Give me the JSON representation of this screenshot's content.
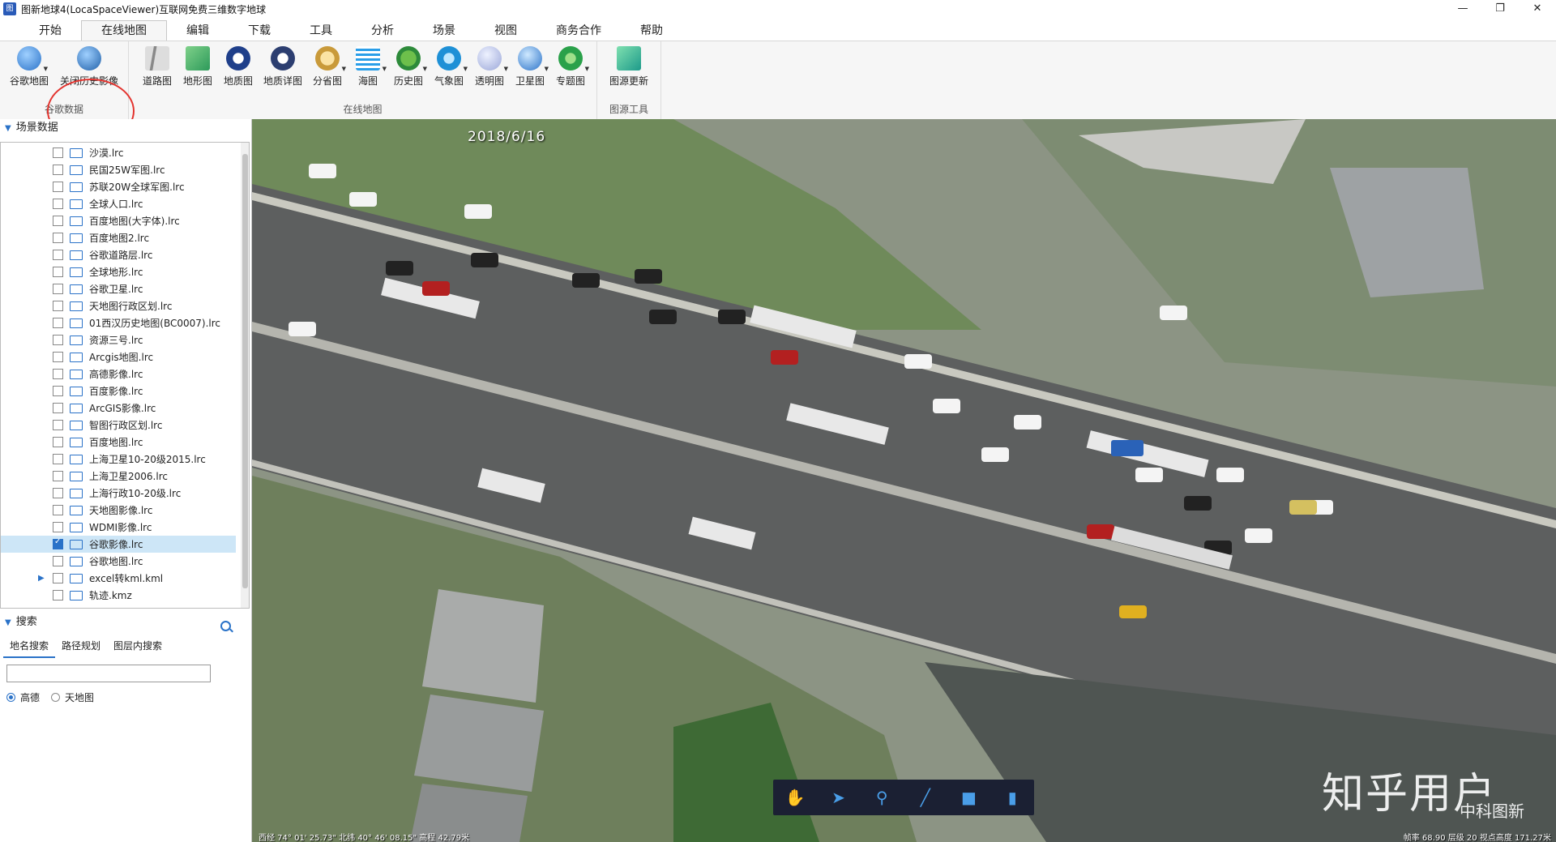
{
  "window": {
    "title": "图新地球4(LocaSpaceViewer)互联网免费三维数字地球",
    "minimize": "—",
    "restore": "❐",
    "close": "✕"
  },
  "menu": {
    "tabs": [
      "开始",
      "在线地图",
      "编辑",
      "下载",
      "工具",
      "分析",
      "场景",
      "视图",
      "商务合作",
      "帮助"
    ],
    "active": "在线地图"
  },
  "ribbon": {
    "groups": [
      {
        "label": "谷歌数据",
        "buttons": [
          "谷歌地图",
          "关闭历史影像"
        ]
      },
      {
        "label": "在线地图",
        "buttons": [
          "道路图",
          "地形图",
          "地质图",
          "地质详图",
          "分省图",
          "海图",
          "历史图",
          "气象图",
          "透明图",
          "卫星图",
          "专题图"
        ]
      },
      {
        "label": "图源工具",
        "buttons": [
          "图源更新"
        ]
      }
    ],
    "colors": {
      "accent": "#2a72c8",
      "highlight_circle": "#e3342f"
    }
  },
  "scene_panel": {
    "header": "场景数据",
    "items": [
      {
        "label": "沙漠.lrc",
        "checked": false
      },
      {
        "label": "民国25W军图.lrc",
        "checked": false
      },
      {
        "label": "苏联20W全球军图.lrc",
        "checked": false
      },
      {
        "label": "全球人口.lrc",
        "checked": false
      },
      {
        "label": "百度地图(大字体).lrc",
        "checked": false
      },
      {
        "label": "百度地图2.lrc",
        "checked": false
      },
      {
        "label": "谷歌道路层.lrc",
        "checked": false
      },
      {
        "label": "全球地形.lrc",
        "checked": false
      },
      {
        "label": "谷歌卫星.lrc",
        "checked": false
      },
      {
        "label": "天地图行政区划.lrc",
        "checked": false
      },
      {
        "label": "01西汉历史地图(BC0007).lrc",
        "checked": false
      },
      {
        "label": "资源三号.lrc",
        "checked": false
      },
      {
        "label": "Arcgis地图.lrc",
        "checked": false
      },
      {
        "label": "高德影像.lrc",
        "checked": false
      },
      {
        "label": "百度影像.lrc",
        "checked": false
      },
      {
        "label": "ArcGIS影像.lrc",
        "checked": false
      },
      {
        "label": "智图行政区划.lrc",
        "checked": false
      },
      {
        "label": "百度地图.lrc",
        "checked": false
      },
      {
        "label": "上海卫星10-20级2015.lrc",
        "checked": false
      },
      {
        "label": "上海卫星2006.lrc",
        "checked": false
      },
      {
        "label": "上海行政10-20级.lrc",
        "checked": false
      },
      {
        "label": "天地图影像.lrc",
        "checked": false
      },
      {
        "label": "WDMI影像.lrc",
        "checked": false
      },
      {
        "label": "谷歌影像.lrc",
        "checked": true
      },
      {
        "label": "谷歌地图.lrc",
        "checked": false
      },
      {
        "label": "excel转kml.kml",
        "checked": false
      },
      {
        "label": "轨迹.kmz",
        "checked": false
      }
    ]
  },
  "search": {
    "header": "搜索",
    "tabs": [
      "地名搜索",
      "路径规划",
      "图层内搜索"
    ],
    "active_tab": "地名搜索",
    "input_value": "",
    "radios": [
      {
        "label": "高德",
        "selected": true
      },
      {
        "label": "天地图",
        "selected": false
      }
    ]
  },
  "map": {
    "date": "2018/6/16",
    "watermark": "知乎用户",
    "watermark_sub": "中科图新",
    "status_left": "西经 74° 01' 25.73\"  北纬 40° 46' 08.15\"  高程 42.79米",
    "status_right": "帧率 68.90  层级 20  视点高度 171.27米",
    "tools": [
      "hand-icon",
      "pointer-icon",
      "marker-icon",
      "line-icon",
      "polygon-icon",
      "chart-icon"
    ]
  }
}
